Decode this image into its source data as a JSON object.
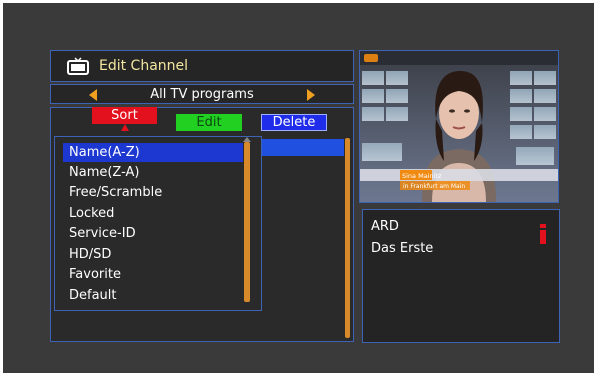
{
  "header": {
    "title": "Edit Channel",
    "icon": "tv-icon"
  },
  "group": {
    "label": "All TV programs"
  },
  "buttons": {
    "sort": "Sort",
    "edit": "Edit",
    "delete": "Delete"
  },
  "sort_menu": {
    "items": [
      {
        "label": "Name(A-Z)",
        "selected": true
      },
      {
        "label": "Name(Z-A)",
        "selected": false
      },
      {
        "label": "Free/Scramble",
        "selected": false
      },
      {
        "label": "Locked",
        "selected": false
      },
      {
        "label": "Service-ID",
        "selected": false
      },
      {
        "label": "HD/SD",
        "selected": false
      },
      {
        "label": "Favorite",
        "selected": false
      },
      {
        "label": "Default",
        "selected": false
      }
    ]
  },
  "preview": {
    "ticker_name": "Sina Mainitz",
    "ticker_sub": "in Frankfurt am Main"
  },
  "channel_info": {
    "line1": "ARD",
    "line2": "Das Erste",
    "icon": "info-icon"
  },
  "colors": {
    "accent_blue": "#1c38d0",
    "border": "#3f63b4",
    "red": "#e3101e",
    "green": "#22d022",
    "orange": "#f0a020"
  }
}
